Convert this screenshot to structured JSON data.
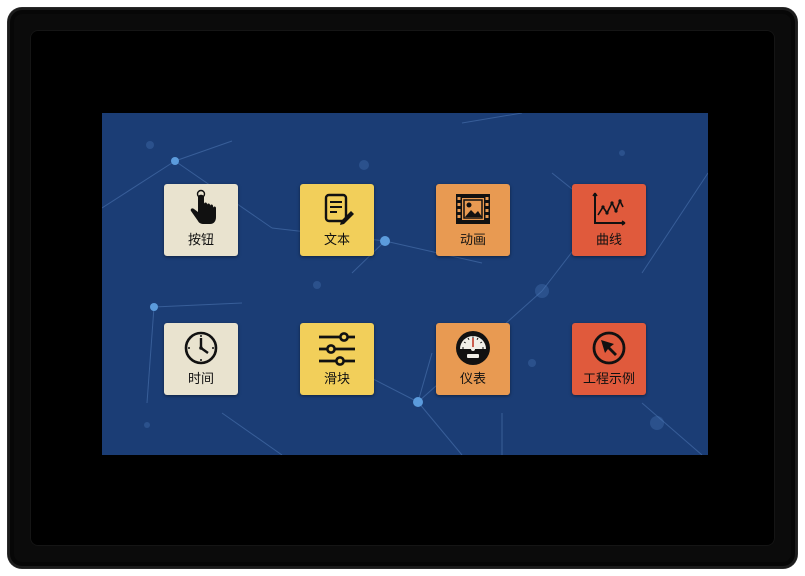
{
  "screen": {
    "background": "#1b3d75",
    "tiles": [
      {
        "label": "按钮",
        "icon": "touch-hand-icon",
        "color": "#e9e3cf"
      },
      {
        "label": "文本",
        "icon": "text-edit-icon",
        "color": "#f2cf5a"
      },
      {
        "label": "动画",
        "icon": "image-film-icon",
        "color": "#e89a52"
      },
      {
        "label": "曲线",
        "icon": "line-chart-icon",
        "color": "#e05a3c"
      },
      {
        "label": "时间",
        "icon": "clock-icon",
        "color": "#e9e3cf"
      },
      {
        "label": "滑块",
        "icon": "sliders-icon",
        "color": "#f2cf5a"
      },
      {
        "label": "仪表",
        "icon": "gauge-meter-icon",
        "color": "#e89a52"
      },
      {
        "label": "工程示例",
        "icon": "cursor-arrow-icon",
        "color": "#e05a3c"
      }
    ]
  }
}
